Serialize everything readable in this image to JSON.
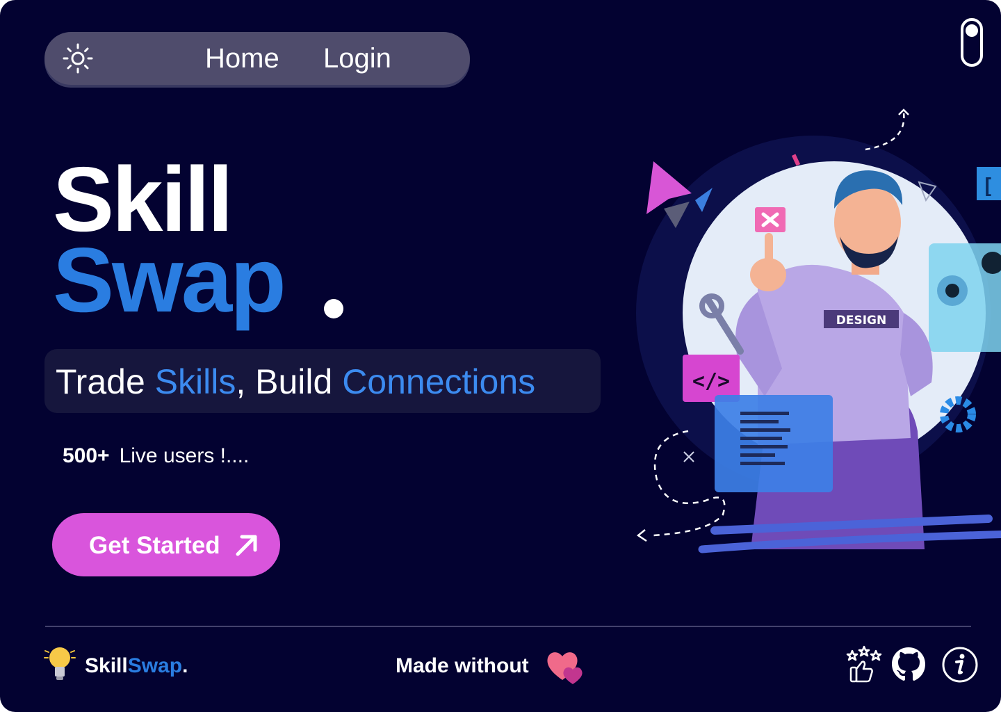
{
  "nav": {
    "theme_icon": "sun-icon",
    "links": [
      {
        "label": "Home"
      },
      {
        "label": "Login"
      }
    ],
    "toggle_icon": "toggle-switch-icon"
  },
  "hero": {
    "title_line1": "Skill",
    "title_line2": "Swap",
    "tagline": {
      "w1": "Trade ",
      "w2": "Skills",
      "w3": ", Build ",
      "w4": "Connections"
    },
    "users_count": "500+",
    "users_text": "Live users !....",
    "cta_label": "Get Started",
    "cta_icon": "arrow-up-right-icon",
    "illustration_badge": "DESIGN",
    "illustration_code": "</>"
  },
  "footer": {
    "logo_icon": "lightbulb-icon",
    "brand_part1": "Skill",
    "brand_part2": "Swap",
    "brand_part3": ".",
    "made_text": "Made without",
    "heart_icon": "hearts-icon",
    "icons": [
      "rating-thumbs-up-icon",
      "github-icon",
      "info-icon"
    ]
  },
  "colors": {
    "background": "#030231",
    "accent_blue": "#2a7de1",
    "cta_pink": "#d955dc",
    "nav_pill": "#4f4c6c"
  }
}
